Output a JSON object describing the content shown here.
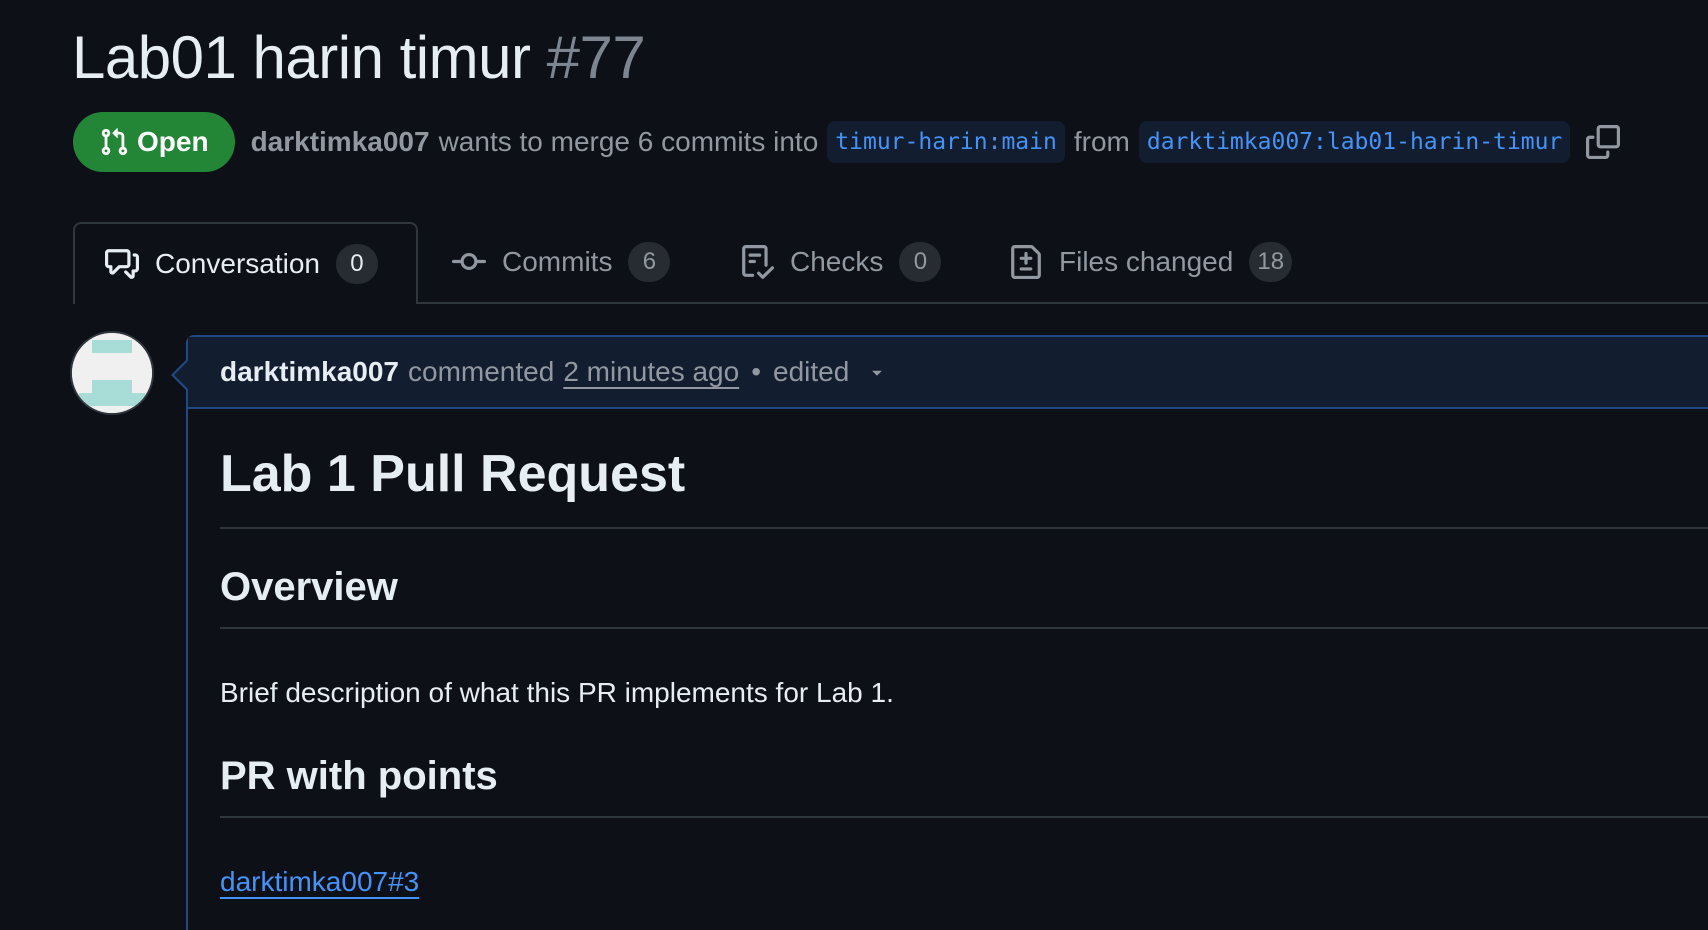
{
  "pr": {
    "title": "Lab01 harin timur",
    "number": "#77",
    "state": "Open",
    "author": "darktimka007",
    "merge_text": "wants to merge 6 commits into",
    "base_branch": "timur-harin:main",
    "from_text": "from",
    "head_branch": "darktimka007:lab01-harin-timur"
  },
  "tabs": [
    {
      "label": "Conversation",
      "count": "0",
      "icon": "comment-discussion-icon"
    },
    {
      "label": "Commits",
      "count": "6",
      "icon": "git-commit-icon"
    },
    {
      "label": "Checks",
      "count": "0",
      "icon": "checklist-icon"
    },
    {
      "label": "Files changed",
      "count": "18",
      "icon": "file-diff-icon"
    }
  ],
  "comment": {
    "author": "darktimka007",
    "action": "commented",
    "time": "2 minutes ago",
    "separator": "•",
    "edited": "edited",
    "body": {
      "h1": "Lab 1 Pull Request",
      "h2_overview": "Overview",
      "overview_text": "Brief description of what this PR implements for Lab 1.",
      "h2_points": "PR with points",
      "points_link": "darktimka007#3"
    }
  },
  "colors": {
    "background": "#0d1117",
    "open_badge": "#238636",
    "link": "#4493f8",
    "comment_border": "#1f4a85"
  }
}
